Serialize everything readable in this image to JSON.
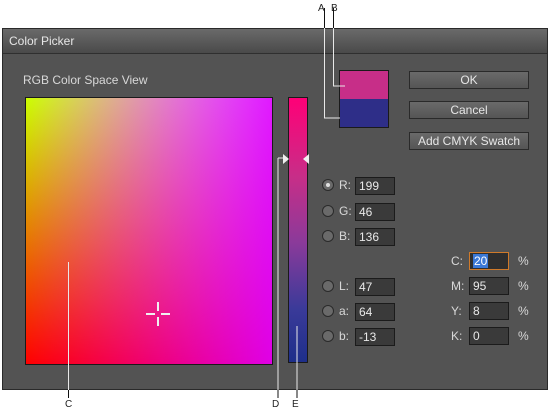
{
  "callouts": {
    "a": "A",
    "b": "B",
    "c": "C",
    "d": "D",
    "e": "E"
  },
  "window": {
    "title": "Color Picker"
  },
  "view_label": "RGB Color Space View",
  "swatches": {
    "new_color": "#C72E88",
    "original_color": "#2E2E88"
  },
  "buttons": {
    "ok": "OK",
    "cancel": "Cancel",
    "add_cmyk": "Add CMYK Swatch"
  },
  "rgb": [
    {
      "label": "R:",
      "value": "199",
      "selected": true
    },
    {
      "label": "G:",
      "value": "46",
      "selected": false
    },
    {
      "label": "B:",
      "value": "136",
      "selected": false
    }
  ],
  "lab": [
    {
      "label": "L:",
      "value": "47"
    },
    {
      "label": "a:",
      "value": "64"
    },
    {
      "label": "b:",
      "value": "-13"
    }
  ],
  "cmyk": [
    {
      "label": "C:",
      "value": "20",
      "unit": "%"
    },
    {
      "label": "M:",
      "value": "95",
      "unit": "%"
    },
    {
      "label": "Y:",
      "value": "8",
      "unit": "%"
    },
    {
      "label": "K:",
      "value": "0",
      "unit": "%"
    }
  ]
}
